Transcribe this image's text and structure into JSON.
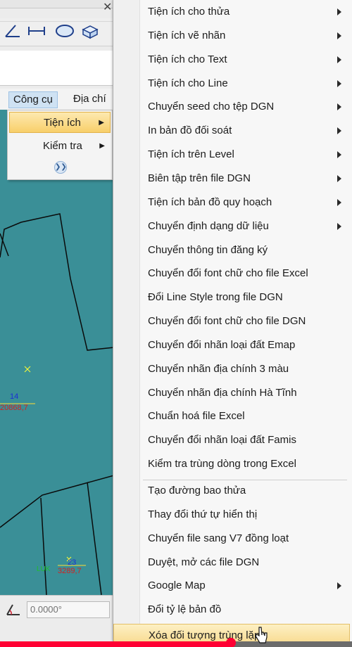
{
  "menubar": {
    "items": [
      {
        "label": "Công cụ",
        "active": true
      },
      {
        "label": "Địa chí"
      }
    ]
  },
  "submenu": {
    "items": [
      {
        "label": "Tiện ích",
        "has_submenu": true,
        "highlighted": true
      },
      {
        "label": "Kiểm tra",
        "has_submenu": true
      }
    ],
    "expand_icon": "chevron-double-down-icon"
  },
  "canvas": {
    "labels": [
      {
        "number": "14",
        "value": "20868,7"
      },
      {
        "number": "23",
        "value": "3289,7",
        "side_value": "LUK"
      }
    ]
  },
  "status": {
    "angle_value": "0.0000°"
  },
  "popup_menu": {
    "items": [
      {
        "label": "Tiện ích cho thửa",
        "has_submenu": true
      },
      {
        "label": "Tiện ích vẽ nhãn",
        "has_submenu": true
      },
      {
        "label": "Tiện ích cho Text",
        "has_submenu": true
      },
      {
        "label": "Tiện ích cho Line",
        "has_submenu": true
      },
      {
        "label": "Chuyển seed cho tệp DGN",
        "has_submenu": true
      },
      {
        "label": "In bản đồ đối soát",
        "has_submenu": true
      },
      {
        "label": "Tiện ích trên Level",
        "has_submenu": true
      },
      {
        "label": "Biên tập trên file DGN",
        "has_submenu": true
      },
      {
        "label": "Tiện ích bản đồ quy hoạch",
        "has_submenu": true
      },
      {
        "label": "Chuyển định dạng dữ liệu",
        "has_submenu": true
      },
      {
        "label": "Chuyển thông tin đăng ký",
        "has_submenu": false
      },
      {
        "label": "Chuyển đổi font chữ cho file Excel",
        "has_submenu": false
      },
      {
        "label": "Đổi Line Style trong file DGN",
        "has_submenu": false
      },
      {
        "label": "Chuyển đổi font chữ cho file DGN",
        "has_submenu": false
      },
      {
        "label": "Chuyển đổi nhãn loại đất Emap",
        "has_submenu": false
      },
      {
        "label": "Chuyển nhãn địa chính 3 màu",
        "has_submenu": false
      },
      {
        "label": "Chuyển nhãn địa chính Hà Tĩnh",
        "has_submenu": false
      },
      {
        "label": "Chuẩn hoá file Excel",
        "has_submenu": false
      },
      {
        "label": "Chuyển đổi nhãn loại đất Famis",
        "has_submenu": false
      },
      {
        "label": "Kiểm tra trùng dòng trong Excel",
        "has_submenu": false
      },
      {
        "label": "Tạo đường bao thửa",
        "has_submenu": false
      },
      {
        "label": "Thay đổi thứ tự hiển thị",
        "has_submenu": false
      },
      {
        "label": "Chuyển file sang V7 đồng loạt",
        "has_submenu": false
      },
      {
        "label": "Duyệt, mở các file DGN",
        "has_submenu": false
      },
      {
        "label": "Google Map",
        "has_submenu": true
      },
      {
        "label": "Đổi tỷ lệ bản đồ",
        "has_submenu": false
      },
      {
        "label": "Xóa đối tượng trùng lặp",
        "has_submenu": false,
        "highlighted": true
      }
    ]
  },
  "video": {
    "progress": 0.655
  },
  "colors": {
    "canvas_bg": "#3a8f97",
    "highlight": "#f7d787",
    "progress": "#ff0033"
  }
}
